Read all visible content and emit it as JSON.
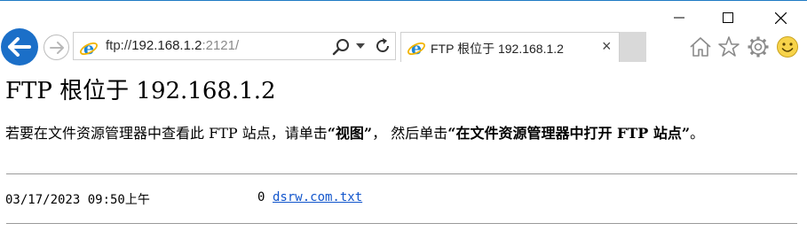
{
  "browser": {
    "address": {
      "prefix": "ftp://",
      "host": "192.168.1.2",
      "port": ":2121/"
    },
    "tab": {
      "title": "FTP 根位于 192.168.1.2",
      "close_glyph": "×"
    },
    "icons": [
      "back-arrow-icon",
      "forward-arrow-icon",
      "ie-logo-icon",
      "search-icon",
      "dropdown-icon",
      "refresh-icon",
      "home-icon",
      "favorites-star-icon",
      "settings-gear-icon",
      "smiley-feedback-icon",
      "minimize-icon",
      "maximize-icon",
      "close-icon"
    ],
    "colors": {
      "back_button": "#1b6fc8",
      "link": "#1155cc",
      "smiley": "#f7d34a"
    }
  },
  "page": {
    "title": "FTP 根位于 192.168.1.2",
    "instructions": {
      "part1": "若要在文件资源管理器中查看此 FTP 站点，请单击",
      "bold1": "“视图”",
      "part2": "， 然后单击",
      "bold2": "“在文件资源管理器中打开 FTP 站点”",
      "part3": "。"
    },
    "files": [
      {
        "date": "03/17/2023 09:50上午",
        "size": "0",
        "name": "dsrw.com.txt"
      }
    ]
  }
}
